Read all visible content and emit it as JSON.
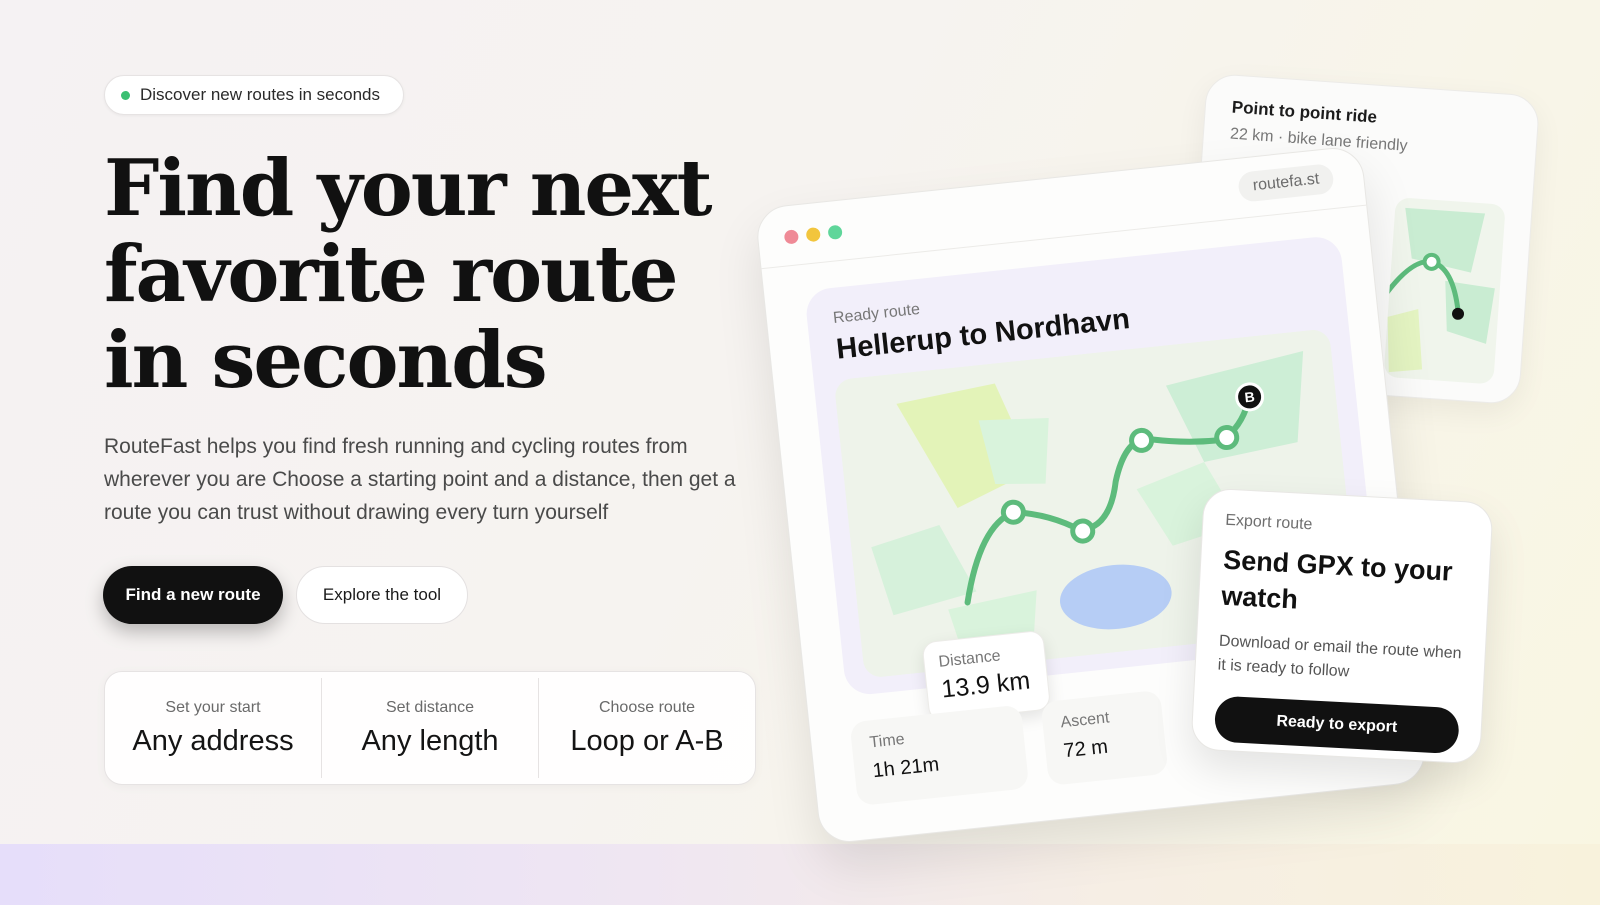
{
  "hero": {
    "badge_text": "Discover new routes in seconds",
    "title_lines": [
      "Find your next",
      "favorite route",
      "in seconds"
    ],
    "description": "RouteFast helps you find fresh running and cycling routes from wherever you are Choose a starting point and a distance, then get a route you can trust without drawing every turn yourself",
    "primary_button": "Find a new route",
    "secondary_button": "Explore the tool"
  },
  "steps": [
    {
      "label": "Set your start",
      "value": "Any address"
    },
    {
      "label": "Set distance",
      "value": "Any length"
    },
    {
      "label": "Choose route",
      "value": "Loop or A-B"
    }
  ],
  "back_card": {
    "title": "Point to point ride",
    "subtitle": "22 km · bike lane friendly"
  },
  "main_card": {
    "url": "routefa.st",
    "route_label": "Ready route",
    "route_title": "Hellerup to Nordhavn",
    "end_marker": "B",
    "distance_label": "Distance",
    "distance_value": "13.9 km",
    "time_label": "Time",
    "time_value": "1h 21m",
    "ascent_label": "Ascent",
    "ascent_value": "72 m"
  },
  "export_card": {
    "label": "Export route",
    "title": "Send GPX to your watch",
    "description": "Download or email the route when it is ready to follow",
    "button": "Ready to export"
  },
  "colors": {
    "accent_green": "#5dbb7c",
    "badge_dot": "#3bbf72",
    "dark": "#111111",
    "water": "#b6cdf5"
  }
}
